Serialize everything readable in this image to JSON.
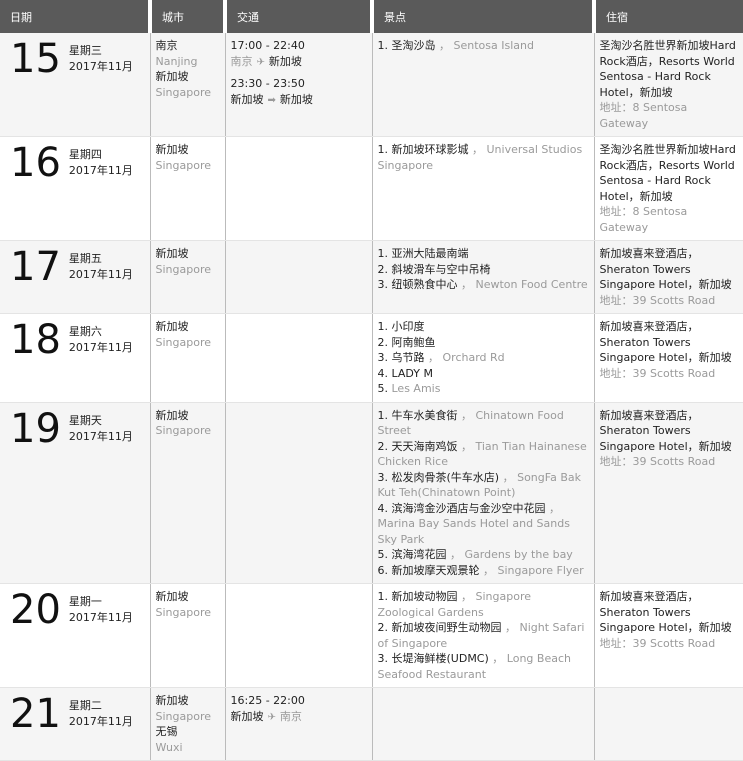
{
  "headers": {
    "date": "日期",
    "city": "城市",
    "transport": "交通",
    "sights": "景点",
    "hotel": "住宿"
  },
  "rows": [
    {
      "day": "15",
      "weekday": "星期三",
      "month": "2017年11月",
      "cities": [
        {
          "cn": "南京",
          "en": "Nanjing"
        },
        {
          "cn": "新加坡",
          "en": "Singapore"
        }
      ],
      "transport": [
        {
          "time": "17:00 - 22:40",
          "from": "南京",
          "to": "新加坡",
          "mode": "plane",
          "from_gray": true
        },
        {
          "time": "23:30 - 23:50",
          "from": "新加坡",
          "to": "新加坡",
          "mode": "arrow",
          "from_gray": false
        }
      ],
      "sights": [
        {
          "n": "1.",
          "cn": "圣淘沙岛",
          "en": "Sentosa Island"
        }
      ],
      "hotel": {
        "name": "圣淘沙名胜世界新加坡Hard Rock酒店，Resorts World Sentosa - Hard Rock Hotel，新加坡",
        "address": "地址：8 Sentosa Gateway"
      }
    },
    {
      "day": "16",
      "weekday": "星期四",
      "month": "2017年11月",
      "cities": [
        {
          "cn": "新加坡",
          "en": "Singapore"
        }
      ],
      "transport": [],
      "sights": [
        {
          "n": "1.",
          "cn": "新加坡环球影城",
          "en": "Universal Studios Singapore"
        }
      ],
      "hotel": {
        "name": "圣淘沙名胜世界新加坡Hard Rock酒店，Resorts World Sentosa - Hard Rock Hotel，新加坡",
        "address": "地址：8 Sentosa Gateway"
      }
    },
    {
      "day": "17",
      "weekday": "星期五",
      "month": "2017年11月",
      "cities": [
        {
          "cn": "新加坡",
          "en": "Singapore"
        }
      ],
      "transport": [],
      "sights": [
        {
          "n": "1.",
          "cn": "亚洲大陆最南端",
          "en": ""
        },
        {
          "n": "2.",
          "cn": "斜坡滑车与空中吊椅",
          "en": ""
        },
        {
          "n": "3.",
          "cn": "纽顿熟食中心",
          "en": "Newton Food Centre"
        }
      ],
      "hotel": {
        "name": "新加坡喜来登酒店，Sheraton Towers Singapore Hotel，新加坡",
        "address": "地址：39 Scotts Road"
      }
    },
    {
      "day": "18",
      "weekday": "星期六",
      "month": "2017年11月",
      "cities": [
        {
          "cn": "新加坡",
          "en": "Singapore"
        }
      ],
      "transport": [],
      "sights": [
        {
          "n": "1.",
          "cn": "小印度",
          "en": ""
        },
        {
          "n": "2.",
          "cn": "阿南鲍鱼",
          "en": ""
        },
        {
          "n": "3.",
          "cn": "乌节路",
          "en": "Orchard Rd"
        },
        {
          "n": "4.",
          "cn": "LADY M",
          "en": ""
        },
        {
          "n": "5.",
          "cn": "",
          "en": "Les Amis"
        }
      ],
      "hotel": {
        "name": "新加坡喜来登酒店，Sheraton Towers Singapore Hotel，新加坡",
        "address": "地址：39 Scotts Road"
      }
    },
    {
      "day": "19",
      "weekday": "星期天",
      "month": "2017年11月",
      "cities": [
        {
          "cn": "新加坡",
          "en": "Singapore"
        }
      ],
      "transport": [],
      "sights": [
        {
          "n": "1.",
          "cn": "牛车水美食街",
          "en": "Chinatown Food Street"
        },
        {
          "n": "2.",
          "cn": "天天海南鸡饭",
          "en": "Tian Tian Hainanese Chicken Rice"
        },
        {
          "n": "3.",
          "cn": "松发肉骨茶(牛车水店)",
          "en": "SongFa Bak Kut Teh(Chinatown Point)"
        },
        {
          "n": "4.",
          "cn": "滨海湾金沙酒店与金沙空中花园",
          "en": "Marina Bay Sands Hotel and Sands Sky Park"
        },
        {
          "n": "5.",
          "cn": "滨海湾花园",
          "en": "Gardens by the bay"
        },
        {
          "n": "6.",
          "cn": "新加坡摩天观景轮",
          "en": "Singapore Flyer"
        }
      ],
      "hotel": {
        "name": "新加坡喜来登酒店，Sheraton Towers Singapore Hotel，新加坡",
        "address": "地址：39 Scotts Road"
      }
    },
    {
      "day": "20",
      "weekday": "星期一",
      "month": "2017年11月",
      "cities": [
        {
          "cn": "新加坡",
          "en": "Singapore"
        }
      ],
      "transport": [],
      "sights": [
        {
          "n": "1.",
          "cn": "新加坡动物园",
          "en": "Singapore Zoological Gardens"
        },
        {
          "n": "2.",
          "cn": "新加坡夜间野生动物园",
          "en": "Night Safari of Singapore"
        },
        {
          "n": "3.",
          "cn": "长堤海鲜楼(UDMC)",
          "en": "Long Beach Seafood Restaurant"
        }
      ],
      "hotel": {
        "name": "新加坡喜来登酒店，Sheraton Towers Singapore Hotel，新加坡",
        "address": "地址：39 Scotts Road"
      }
    },
    {
      "day": "21",
      "weekday": "星期二",
      "month": "2017年11月",
      "cities": [
        {
          "cn": "新加坡",
          "en": "Singapore"
        },
        {
          "cn": "无锡",
          "en": "Wuxi"
        }
      ],
      "transport": [
        {
          "time": "16:25 - 22:00",
          "from": "新加坡",
          "to": "南京",
          "mode": "plane",
          "from_gray": false,
          "to_gray": true
        }
      ],
      "sights": [],
      "hotel": null
    }
  ]
}
